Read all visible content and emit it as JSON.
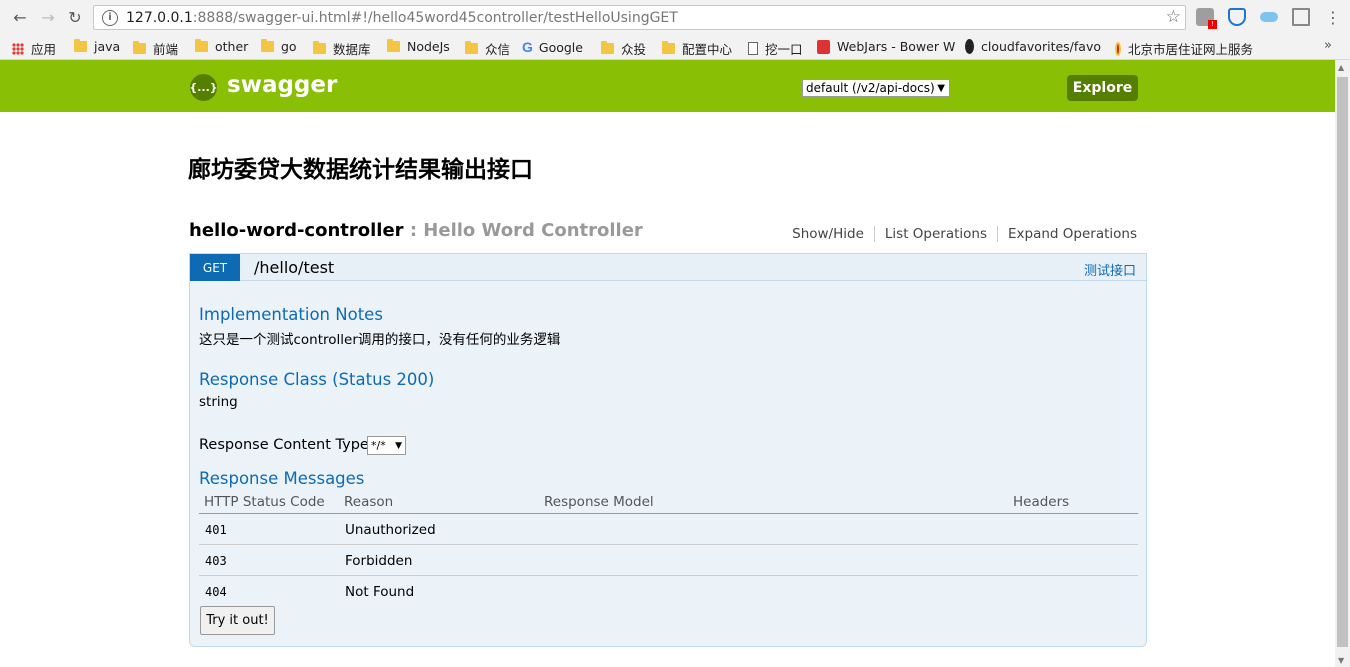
{
  "browser": {
    "url_host": "127.0.0.1",
    "url_rest": ":8888/swagger-ui.html#!/hello45word45controller/testHelloUsingGET"
  },
  "bookmarks": [
    {
      "label": "应用",
      "icon": "apps-icon"
    },
    {
      "label": "java",
      "icon": "folder-icon"
    },
    {
      "label": "前端",
      "icon": "folder-icon"
    },
    {
      "label": "other",
      "icon": "folder-icon"
    },
    {
      "label": "go",
      "icon": "folder-icon"
    },
    {
      "label": "数据库",
      "icon": "folder-icon"
    },
    {
      "label": "NodeJs",
      "icon": "folder-icon"
    },
    {
      "label": "众信",
      "icon": "folder-icon"
    },
    {
      "label": "Google",
      "icon": "google-icon"
    },
    {
      "label": "众投",
      "icon": "folder-icon"
    },
    {
      "label": "配置中心",
      "icon": "folder-icon"
    },
    {
      "label": "挖一口",
      "icon": "page-icon"
    },
    {
      "label": "WebJars - Bower W",
      "icon": "webjars-icon"
    },
    {
      "label": "cloudfavorites/favo",
      "icon": "github-icon"
    },
    {
      "label": "北京市居住证网上服务",
      "icon": "emblem-icon"
    }
  ],
  "swagger": {
    "logo_text": "{...}",
    "brand": "swagger",
    "spec_select": "default (/v2/api-docs)",
    "explore_label": "Explore",
    "accent": "#89bf04"
  },
  "api": {
    "title": "廊坊委贷大数据统计结果输出接口"
  },
  "resource": {
    "name": "hello-word-controller",
    "separator": " : ",
    "description": "Hello Word Controller",
    "links": {
      "show_hide": "Show/Hide",
      "list_operations": "List Operations",
      "expand_operations": "Expand Operations"
    }
  },
  "operation": {
    "method": "GET",
    "path": "/hello/test",
    "summary": "测试接口",
    "implementation_notes_title": "Implementation Notes",
    "implementation_notes": "这只是一个测试controller调用的接口，没有任何的业务逻辑",
    "response_class_title": "Response Class (Status 200)",
    "response_class": "string",
    "response_content_type_label": "Response Content Type",
    "response_content_type": "*/*",
    "response_messages_title": "Response Messages",
    "table_headers": {
      "code": "HTTP Status Code",
      "reason": "Reason",
      "model": "Response Model",
      "headers": "Headers"
    },
    "responses": [
      {
        "code": "401",
        "reason": "Unauthorized"
      },
      {
        "code": "403",
        "reason": "Forbidden"
      },
      {
        "code": "404",
        "reason": "Not Found"
      }
    ],
    "try_label": "Try it out!"
  }
}
